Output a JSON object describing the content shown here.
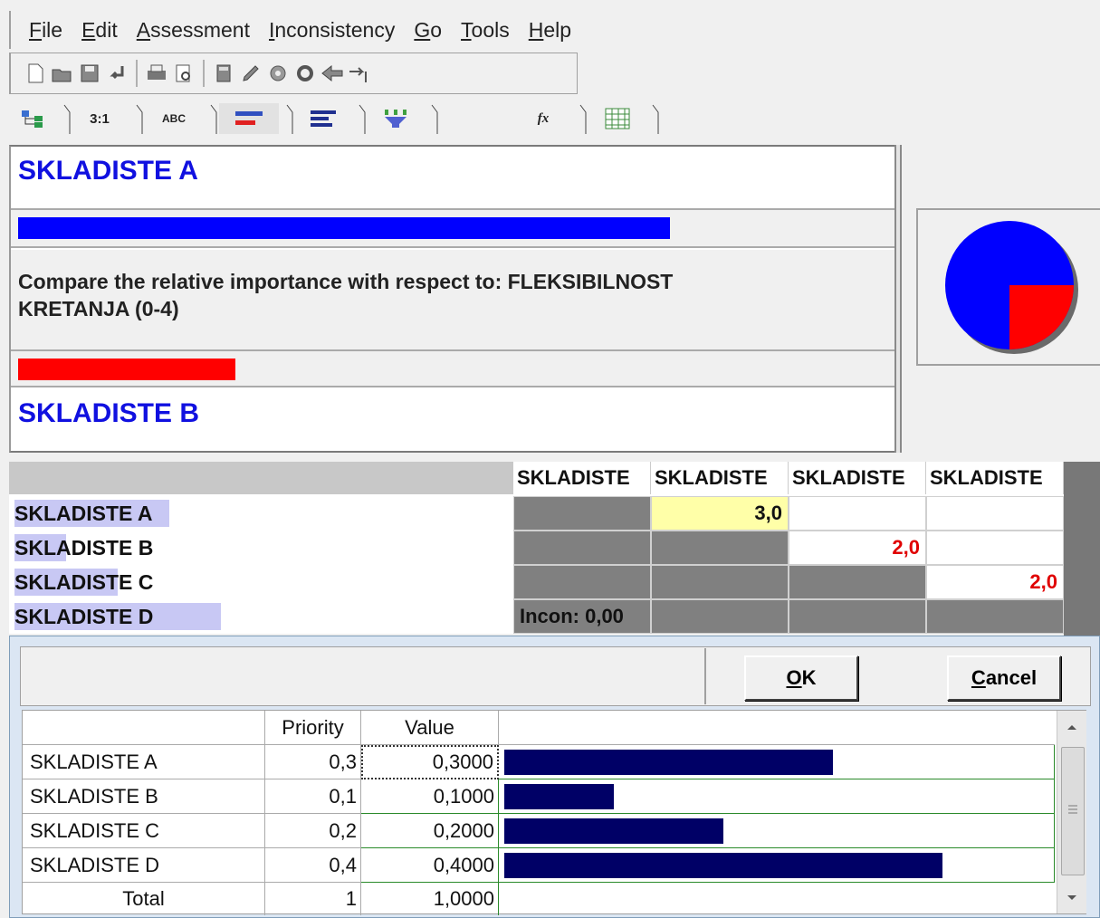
{
  "menu": [
    {
      "label": "File",
      "accel": "F"
    },
    {
      "label": "Edit",
      "accel": "E"
    },
    {
      "label": "Assessment",
      "accel": "A"
    },
    {
      "label": "Inconsistency",
      "accel": "I"
    },
    {
      "label": "Go",
      "accel": "G"
    },
    {
      "label": "Tools",
      "accel": "T"
    },
    {
      "label": "Help",
      "accel": "H"
    }
  ],
  "toolbar_icons": [
    "new-icon",
    "open-icon",
    "save-icon",
    "undo-icon",
    "print-icon",
    "print-preview-icon",
    "calculator-icon",
    "edit-icon",
    "synthesize-icon",
    "refresh-icon",
    "sensitivity-icon",
    "goto-icon"
  ],
  "tabs": [
    {
      "name": "tab-tree",
      "label": "",
      "icon": "tree-icon"
    },
    {
      "name": "tab-ratio",
      "label": "3:1",
      "icon": ""
    },
    {
      "name": "tab-verbal",
      "label": "ABC",
      "icon": ""
    },
    {
      "name": "tab-graphical",
      "label": "",
      "icon": "graphical-bars-icon"
    },
    {
      "name": "tab-bars",
      "label": "",
      "icon": "bars-icon"
    },
    {
      "name": "tab-funnel",
      "label": "",
      "icon": "funnel-icon"
    },
    {
      "name": "tab-formula",
      "label": "fx",
      "icon": "formula-icon"
    },
    {
      "name": "tab-grid",
      "label": "",
      "icon": "grid-icon"
    }
  ],
  "comparison": {
    "node_a": "SKLADISTE A",
    "node_b": "SKLADISTE B",
    "question_line1": "Compare the relative importance with respect to: FLEKSIBILNOST",
    "question_line2": "KRETANJA (0-4)",
    "bar_a_fraction": 0.75,
    "bar_b_fraction": 0.25,
    "color_a": "#0000ff",
    "color_b": "#ff0000"
  },
  "pie": {
    "a_fraction": 0.75,
    "b_fraction": 0.25
  },
  "matrix": {
    "col_headers": [
      "SKLADISTE",
      "SKLADISTE",
      "SKLADISTE",
      "SKLADISTE"
    ],
    "rows": [
      {
        "label": "SKLADISTE A",
        "highlight_fraction": 0.3
      },
      {
        "label": "SKLADISTE B",
        "highlight_fraction": 0.1
      },
      {
        "label": "SKLADISTE C",
        "highlight_fraction": 0.2
      },
      {
        "label": "SKLADISTE D",
        "highlight_fraction": 0.4
      }
    ],
    "cells": {
      "r0c1": "3,0",
      "r1c2": "2,0",
      "r2c3": "2,0",
      "r3c0": "Incon: 0,00"
    }
  },
  "dialog": {
    "ok_label": "OK",
    "cancel_label": "Cancel",
    "headers": {
      "priority": "Priority",
      "value": "Value"
    },
    "rows": [
      {
        "name": "SKLADISTE A",
        "priority": "0,3",
        "value": "0,3000",
        "fraction": 0.3
      },
      {
        "name": "SKLADISTE B",
        "priority": "0,1",
        "value": "0,1000",
        "fraction": 0.1
      },
      {
        "name": "SKLADISTE C",
        "priority": "0,2",
        "value": "0,2000",
        "fraction": 0.2
      },
      {
        "name": "SKLADISTE D",
        "priority": "0,4",
        "value": "0,4000",
        "fraction": 0.4
      }
    ],
    "total": {
      "name": "Total",
      "priority": "1",
      "value": "1,0000"
    }
  }
}
